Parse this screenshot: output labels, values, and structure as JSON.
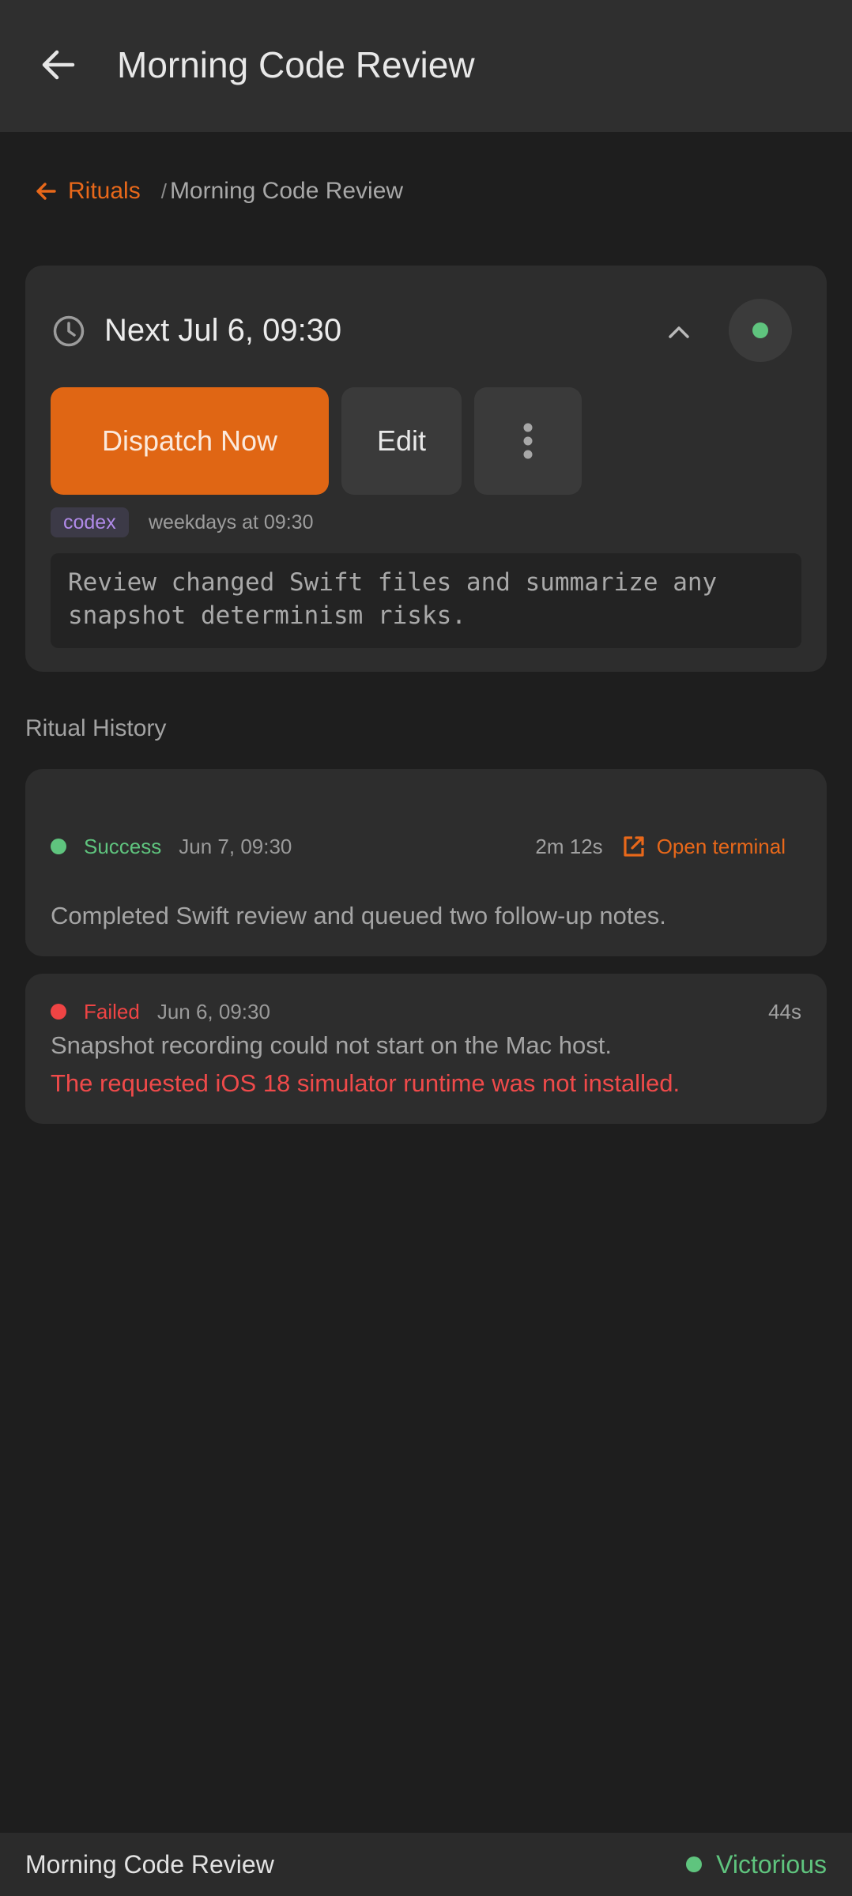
{
  "app_bar": {
    "title": "Morning Code Review",
    "back_icon": "arrow-left-icon"
  },
  "breadcrumb": {
    "parent_label": "Rituals",
    "separator": "/",
    "current_label": "Morning Code Review"
  },
  "schedule": {
    "next_run_label": "Next Jul 6, 09:30",
    "clock_icon": "clock-icon",
    "collapse_icon": "chevron-up-icon",
    "status_color": "#5fc47e",
    "dispatch_label": "Dispatch Now",
    "edit_label": "Edit",
    "more_icon": "more-vertical-icon",
    "agent": "codex",
    "cadence": "weekdays at 09:30",
    "prompt": "Review changed Swift files and summarize any snapshot determinism risks."
  },
  "history": {
    "title": "Ritual History",
    "runs": [
      {
        "status": "Success",
        "date": "Jun 7, 09:30",
        "duration": "2m 12s",
        "action_label": "Open terminal",
        "summary": "Completed Swift review and queued two follow-up notes."
      },
      {
        "status": "Failed",
        "date": "Jun 6, 09:30",
        "duration": "44s",
        "summary": "Snapshot recording could not start on the Mac host.",
        "error": "The requested iOS 18 simulator runtime was not installed."
      }
    ]
  },
  "footer": {
    "title": "Morning Code Review",
    "status": "Victorious"
  },
  "colors": {
    "accent": "#e06614",
    "success": "#5fc47e",
    "error": "#ef4444",
    "agent_badge": "#b08ae8"
  }
}
